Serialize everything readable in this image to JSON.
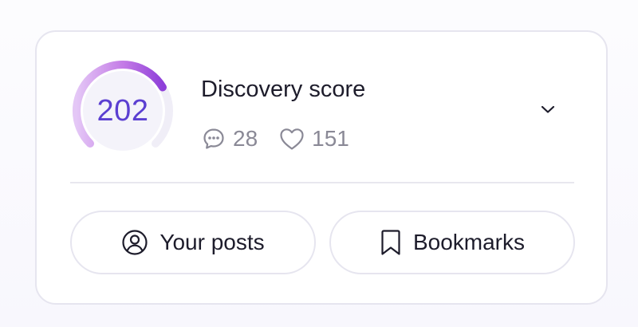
{
  "score": {
    "value": "202",
    "title": "Discovery score",
    "gauge_fill_fraction": 0.72,
    "gauge_colors": [
      "#e4c7f6",
      "#c37ae6",
      "#8e3fd9"
    ],
    "value_color": "#5b3fd1"
  },
  "stats": {
    "comments": {
      "icon": "comment-bubble-icon",
      "value": "28"
    },
    "likes": {
      "icon": "heart-icon",
      "value": "151"
    }
  },
  "expand_toggle": {
    "icon": "chevron-down-icon"
  },
  "actions": {
    "your_posts": {
      "icon": "user-circle-icon",
      "label": "Your posts"
    },
    "bookmarks": {
      "icon": "bookmark-icon",
      "label": "Bookmarks"
    }
  }
}
